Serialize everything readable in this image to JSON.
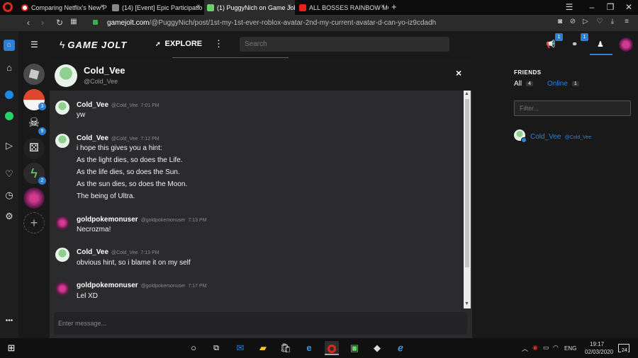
{
  "browser": {
    "tabs": [
      {
        "title": "Comparing Netflix's New P"
      },
      {
        "title": "(14) [Event] Epic Participatio"
      },
      {
        "title": "(1) PuggyNich on Game Jol"
      },
      {
        "title": "ALL BOSSES RAINBOW MC"
      }
    ],
    "new_tab": "+",
    "url_host": "gamejolt.com",
    "url_path": "/@PuggyNich/post/1st-my-1st-ever-roblox-avatar-2nd-my-current-avatar-d-can-yo-iz9cdadh",
    "ext_badge_1": "1",
    "ext_badge_2": "1"
  },
  "gamejolt": {
    "logo": "GAME JOLT",
    "explore": "EXPLORE",
    "search_placeholder": "Search",
    "sidebar_badges": [
      "3",
      "9",
      "2"
    ]
  },
  "chat": {
    "title": "Cold_Vee",
    "subtitle": "@Cold_Vee",
    "close": "×",
    "input_placeholder": "Enter message...",
    "messages": [
      {
        "user": "Cold_Vee",
        "handle": "@Cold_Vee",
        "time": "7:01 PM",
        "lines": [
          "yw"
        ]
      },
      {
        "user": "Cold_Vee",
        "handle": "@Cold_Vee",
        "time": "7:12 PM",
        "lines": [
          "i hope this gives you a hint:",
          "As the light dies, so does the Life.",
          "As the life dies, so does the Sun.",
          "As the sun dies, so does the Moon.",
          "The being of Ultra."
        ]
      },
      {
        "user": "goldpokemonuser",
        "handle": "@goldpokemonuser",
        "time": "7:13 PM",
        "lines": [
          "Necrozma!"
        ]
      },
      {
        "user": "Cold_Vee",
        "handle": "@Cold_Vee",
        "time": "7:13 PM",
        "lines": [
          "obvious hint, so i blame it on my self"
        ]
      },
      {
        "user": "goldpokemonuser",
        "handle": "@goldpokemonuser",
        "time": "7:17 PM",
        "lines": [
          "Lel XD"
        ]
      }
    ]
  },
  "friends": {
    "heading": "FRIENDS",
    "all_label": "All",
    "all_count": "4",
    "online_label": "Online",
    "online_count": "1",
    "filter_placeholder": "Filter...",
    "list": [
      {
        "name": "Cold_Vee",
        "handle": "@Cold_Vee"
      }
    ]
  },
  "taskbar": {
    "lang": "ENG",
    "time": "19:17",
    "date": "02/03/2020",
    "notif_count": "24"
  },
  "colors": {
    "accent": "#2f7fd6",
    "gj_green": "#6bd16b",
    "red": "#d8201c"
  }
}
